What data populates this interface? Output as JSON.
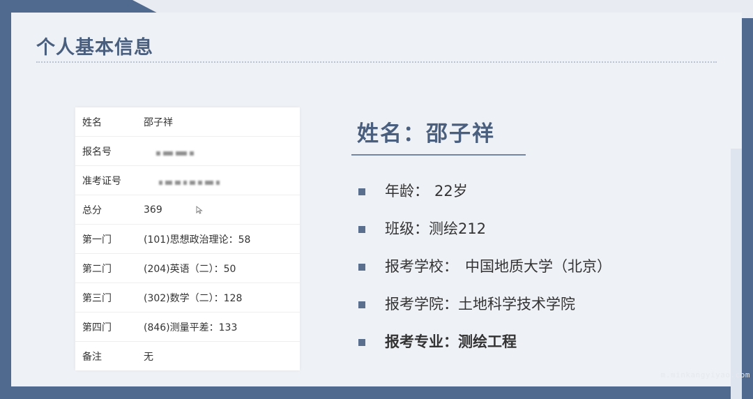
{
  "slide": {
    "title": "个人基本信息"
  },
  "table": {
    "rows": [
      {
        "key": "姓名",
        "value": "邵子祥"
      },
      {
        "key": "报名号",
        "value": ""
      },
      {
        "key": "准考证号",
        "value": ""
      },
      {
        "key": "总分",
        "value": "369"
      },
      {
        "key": "第一门",
        "value": "(101)思想政治理论：58"
      },
      {
        "key": "第二门",
        "value": "(204)英语（二）：50"
      },
      {
        "key": "第三门",
        "value": "(302)数学（二）：128"
      },
      {
        "key": "第四门",
        "value": "(846)测量平差：133"
      },
      {
        "key": "备注",
        "value": "无"
      }
    ]
  },
  "profile": {
    "heading": "姓名：邵子祥",
    "items": [
      {
        "label": "年龄：",
        "value": "22岁"
      },
      {
        "label": "班级：",
        "value": "测绘212"
      },
      {
        "label": "报考学校：",
        "value": "中国地质大学（北京）"
      },
      {
        "label": "报考学院：",
        "value": "土地科学技术学院"
      },
      {
        "label": "报考专业：",
        "value": "测绘工程"
      }
    ]
  },
  "watermark": "m.minkangyiyao.com",
  "colors": {
    "frame": "#4f6a8e",
    "slide_bg": "#eef1f6",
    "heading": "#4a5f7e",
    "bullet": "#5a6f8e"
  },
  "icons": {
    "cursor": "mouse-pointer-icon",
    "bullet": "square-bullet-icon"
  }
}
